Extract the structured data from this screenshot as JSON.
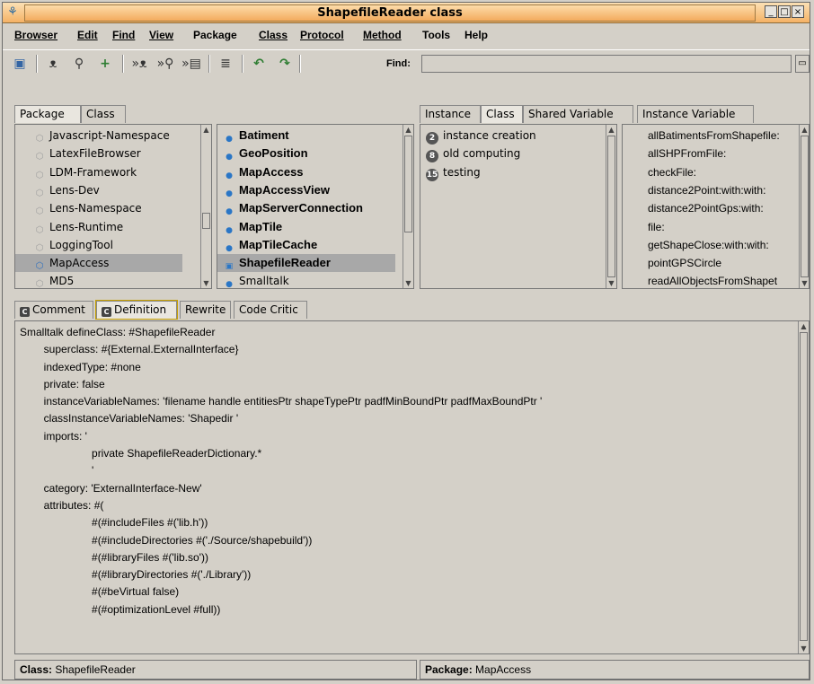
{
  "window": {
    "title": "ShapefileReader class"
  },
  "menubar": [
    "Browser",
    "Edit",
    "Find",
    "View",
    "Package",
    "Class",
    "Protocol",
    "Method",
    "Tools",
    "Help"
  ],
  "toolbar": {
    "find_label": "Find:",
    "find_value": ""
  },
  "left_tabs": [
    "Package",
    "Class"
  ],
  "packages": [
    "Javascript-Namespace",
    "LatexFileBrowser",
    "LDM-Framework",
    "Lens-Dev",
    "Lens-Namespace",
    "Lens-Runtime",
    "LoggingTool",
    "MapAccess",
    "MD5"
  ],
  "selected_package_index": 7,
  "classes": [
    "Batiment",
    "GeoPosition",
    "MapAccess",
    "MapAccessView",
    "MapServerConnection",
    "MapTile",
    "MapTileCache",
    "ShapefileReader",
    "Smalltalk"
  ],
  "selected_class_index": 7,
  "right_tabs": [
    "Instance",
    "Class",
    "Shared Variable",
    "Instance Variable"
  ],
  "protocols": [
    {
      "count": "2",
      "name": "instance creation"
    },
    {
      "count": "8",
      "name": "old computing"
    },
    {
      "count": "15",
      "name": "testing"
    }
  ],
  "methods": [
    "allBatimentsFromShapefile:",
    "allSHPFromFile:",
    "checkFile:",
    "distance2Point:with:with:",
    "distance2PointGps:with:",
    "file:",
    "getShapeClose:with:with:",
    "pointGPSCircle",
    "readAllObjectsFromShapet"
  ],
  "code_tabs": [
    "Comment",
    "Definition",
    "Rewrite",
    "Code Critic"
  ],
  "active_code_tab": "Definition",
  "definition_lines": [
    "Smalltalk defineClass: #ShapefileReader",
    "        superclass: #{External.ExternalInterface}",
    "        indexedType: #none",
    "        private: false",
    "        instanceVariableNames: 'filename handle entitiesPtr shapeTypePtr padfMinBoundPtr padfMaxBoundPtr '",
    "        classInstanceVariableNames: 'Shapedir '",
    "        imports: '",
    "                        private ShapefileReaderDictionary.*",
    "                        '",
    "        category: 'ExternalInterface-New'",
    "        attributes: #(",
    "                        #(#includeFiles #('lib.h'))",
    "                        #(#includeDirectories #('./Source/shapebuild'))",
    "                        #(#libraryFiles #('lib.so'))",
    "                        #(#libraryDirectories #('./Library'))",
    "                        #(#beVirtual false)",
    "                        #(#optimizationLevel #full))"
  ],
  "status": {
    "class_label": "Class:",
    "class_value": "ShapefileReader",
    "package_label": "Package:",
    "package_value": "MapAccess"
  }
}
